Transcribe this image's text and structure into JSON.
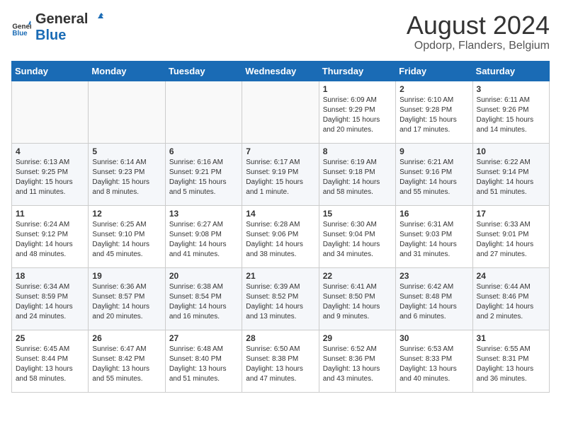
{
  "header": {
    "logo_line1": "General",
    "logo_line2": "Blue",
    "month_year": "August 2024",
    "location": "Opdorp, Flanders, Belgium"
  },
  "days_of_week": [
    "Sunday",
    "Monday",
    "Tuesday",
    "Wednesday",
    "Thursday",
    "Friday",
    "Saturday"
  ],
  "weeks": [
    [
      {
        "day": "",
        "content": ""
      },
      {
        "day": "",
        "content": ""
      },
      {
        "day": "",
        "content": ""
      },
      {
        "day": "",
        "content": ""
      },
      {
        "day": "1",
        "content": "Sunrise: 6:09 AM\nSunset: 9:29 PM\nDaylight: 15 hours and 20 minutes."
      },
      {
        "day": "2",
        "content": "Sunrise: 6:10 AM\nSunset: 9:28 PM\nDaylight: 15 hours and 17 minutes."
      },
      {
        "day": "3",
        "content": "Sunrise: 6:11 AM\nSunset: 9:26 PM\nDaylight: 15 hours and 14 minutes."
      }
    ],
    [
      {
        "day": "4",
        "content": "Sunrise: 6:13 AM\nSunset: 9:25 PM\nDaylight: 15 hours and 11 minutes."
      },
      {
        "day": "5",
        "content": "Sunrise: 6:14 AM\nSunset: 9:23 PM\nDaylight: 15 hours and 8 minutes."
      },
      {
        "day": "6",
        "content": "Sunrise: 6:16 AM\nSunset: 9:21 PM\nDaylight: 15 hours and 5 minutes."
      },
      {
        "day": "7",
        "content": "Sunrise: 6:17 AM\nSunset: 9:19 PM\nDaylight: 15 hours and 1 minute."
      },
      {
        "day": "8",
        "content": "Sunrise: 6:19 AM\nSunset: 9:18 PM\nDaylight: 14 hours and 58 minutes."
      },
      {
        "day": "9",
        "content": "Sunrise: 6:21 AM\nSunset: 9:16 PM\nDaylight: 14 hours and 55 minutes."
      },
      {
        "day": "10",
        "content": "Sunrise: 6:22 AM\nSunset: 9:14 PM\nDaylight: 14 hours and 51 minutes."
      }
    ],
    [
      {
        "day": "11",
        "content": "Sunrise: 6:24 AM\nSunset: 9:12 PM\nDaylight: 14 hours and 48 minutes."
      },
      {
        "day": "12",
        "content": "Sunrise: 6:25 AM\nSunset: 9:10 PM\nDaylight: 14 hours and 45 minutes."
      },
      {
        "day": "13",
        "content": "Sunrise: 6:27 AM\nSunset: 9:08 PM\nDaylight: 14 hours and 41 minutes."
      },
      {
        "day": "14",
        "content": "Sunrise: 6:28 AM\nSunset: 9:06 PM\nDaylight: 14 hours and 38 minutes."
      },
      {
        "day": "15",
        "content": "Sunrise: 6:30 AM\nSunset: 9:04 PM\nDaylight: 14 hours and 34 minutes."
      },
      {
        "day": "16",
        "content": "Sunrise: 6:31 AM\nSunset: 9:03 PM\nDaylight: 14 hours and 31 minutes."
      },
      {
        "day": "17",
        "content": "Sunrise: 6:33 AM\nSunset: 9:01 PM\nDaylight: 14 hours and 27 minutes."
      }
    ],
    [
      {
        "day": "18",
        "content": "Sunrise: 6:34 AM\nSunset: 8:59 PM\nDaylight: 14 hours and 24 minutes."
      },
      {
        "day": "19",
        "content": "Sunrise: 6:36 AM\nSunset: 8:57 PM\nDaylight: 14 hours and 20 minutes."
      },
      {
        "day": "20",
        "content": "Sunrise: 6:38 AM\nSunset: 8:54 PM\nDaylight: 14 hours and 16 minutes."
      },
      {
        "day": "21",
        "content": "Sunrise: 6:39 AM\nSunset: 8:52 PM\nDaylight: 14 hours and 13 minutes."
      },
      {
        "day": "22",
        "content": "Sunrise: 6:41 AM\nSunset: 8:50 PM\nDaylight: 14 hours and 9 minutes."
      },
      {
        "day": "23",
        "content": "Sunrise: 6:42 AM\nSunset: 8:48 PM\nDaylight: 14 hours and 6 minutes."
      },
      {
        "day": "24",
        "content": "Sunrise: 6:44 AM\nSunset: 8:46 PM\nDaylight: 14 hours and 2 minutes."
      }
    ],
    [
      {
        "day": "25",
        "content": "Sunrise: 6:45 AM\nSunset: 8:44 PM\nDaylight: 13 hours and 58 minutes."
      },
      {
        "day": "26",
        "content": "Sunrise: 6:47 AM\nSunset: 8:42 PM\nDaylight: 13 hours and 55 minutes."
      },
      {
        "day": "27",
        "content": "Sunrise: 6:48 AM\nSunset: 8:40 PM\nDaylight: 13 hours and 51 minutes."
      },
      {
        "day": "28",
        "content": "Sunrise: 6:50 AM\nSunset: 8:38 PM\nDaylight: 13 hours and 47 minutes."
      },
      {
        "day": "29",
        "content": "Sunrise: 6:52 AM\nSunset: 8:36 PM\nDaylight: 13 hours and 43 minutes."
      },
      {
        "day": "30",
        "content": "Sunrise: 6:53 AM\nSunset: 8:33 PM\nDaylight: 13 hours and 40 minutes."
      },
      {
        "day": "31",
        "content": "Sunrise: 6:55 AM\nSunset: 8:31 PM\nDaylight: 13 hours and 36 minutes."
      }
    ]
  ]
}
